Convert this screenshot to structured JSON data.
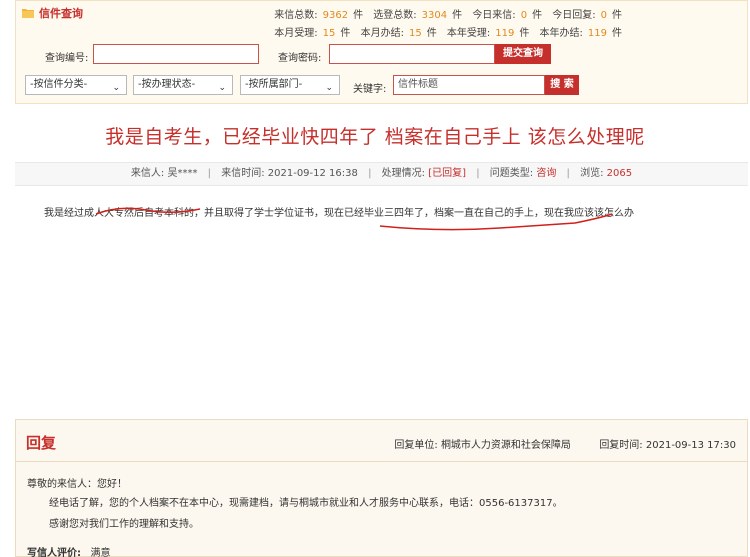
{
  "header": {
    "title": "信件查询",
    "stats_row1": [
      {
        "label": "来信总数:",
        "value": "9362",
        "unit": "件"
      },
      {
        "label": "选登总数:",
        "value": "3304",
        "unit": "件"
      },
      {
        "label": "今日来信:",
        "value": "0",
        "unit": "件"
      },
      {
        "label": "今日回复:",
        "value": "0",
        "unit": "件"
      }
    ],
    "stats_row2": [
      {
        "label": "本月受理:",
        "value": "15",
        "unit": "件"
      },
      {
        "label": "本月办结:",
        "value": "15",
        "unit": "件"
      },
      {
        "label": "本年受理:",
        "value": "119",
        "unit": "件"
      },
      {
        "label": "本年办结:",
        "value": "119",
        "unit": "件"
      }
    ]
  },
  "search": {
    "query_no_label": "查询编号:",
    "query_pwd_label": "查询密码:",
    "submit_label": "提交查询",
    "category_select": "-按信件分类-",
    "status_select": "-按办理状态-",
    "dept_select": "-按所属部门-",
    "keyword_label": "关键字:",
    "keyword_value": "信件标题",
    "search_button": "搜 索"
  },
  "letter": {
    "title": "我是自考生，已经毕业快四年了 档案在自己手上 该怎么处理呢",
    "sender_label": "来信人:",
    "sender": "吴****",
    "time_label": "来信时间:",
    "time": "2021-09-12 16:38",
    "status_label": "处理情况:",
    "status": "[已回复]",
    "type_label": "问题类型:",
    "type": "咨询",
    "views_label": "浏览:",
    "views": "2065",
    "body": "我是经过成人大专然后自考本科的，并且取得了学士学位证书，现在已经毕业三四年了，档案一直在自己的手上，现在我应该该怎么办"
  },
  "reply": {
    "title": "回复",
    "unit_label": "回复单位:",
    "unit": "桐城市人力资源和社会保障局",
    "time_label": "回复时间:",
    "time": "2021-09-13 17:30",
    "greeting": "尊敬的来信人：您好！",
    "body": "经电话了解，您的个人档案不在本中心，现需建档，请与桐城市就业和人才服务中心联系，电话：0556-6137317。",
    "thanks": "感谢您对我们工作的理解和支持。",
    "eval_label": "写信人评价:",
    "eval": "满意"
  },
  "colors": {
    "accent": "#c6302c",
    "number": "#e08a1e",
    "ink": "#d0201a"
  },
  "icons": {
    "header": "folder-icon",
    "select": "chevron-down-icon"
  }
}
